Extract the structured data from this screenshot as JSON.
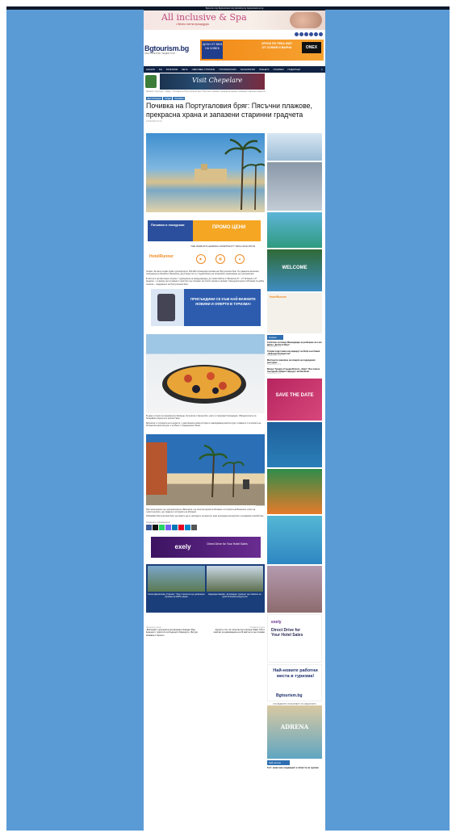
{
  "top_links": "Bgtourism.bg    Bgdestination.bg    bgholiday.bg    bgdestinations.bg",
  "banner_top": {
    "title": "All inclusive & Spa",
    "subtitle": "• Вечно лятна процедура"
  },
  "site": {
    "logo": "Bgtourism.bg",
    "logo_sub": "НАШ СЪВЕТНИК | МЕДИЯ ГРУП"
  },
  "promo": {
    "box": "ЦЕНИ ОТ 580€ НА ЧОВЕК",
    "mid_title": "КРУИЗ ПО РЕКА НИЛ",
    "mid_sub": "ОТ СОФИЯ И ВАРНА",
    "brand": "ONEX"
  },
  "nav": [
    "НАЧАЛО",
    "BG",
    "БЪЛГАРИЯ",
    "МЕТА",
    "СВЕТОВЕН ТУРИЗЪМ",
    "ТУРОПЕРАТОРИ",
    "ТЕХНОЛОГИИ",
    "ПЛАНЕТА",
    "ПОЧИВКИ",
    "ПОДАРЪЦИ"
  ],
  "ad_strip": {
    "title": "Visit Chepelare"
  },
  "breadcrumb": "Начало > Култура > Гайди > Почивка на Португалския бряг: Пясъчни плажове, прекрасна храна и запазени старинни градчета",
  "tags": [
    "ДЕСТИНАЦИИ",
    "ГАЙДИ",
    "ПОЧИВКА"
  ],
  "article": {
    "title": "Почивка на Португаловия бряг: Пясъчни плажове, прекрасна храна и запазени старинни градчета",
    "date": "16/06/2025 07:20",
    "hotelrunner": "THE WORLD'S LEADING HOSPITALITY TECH SOLUTION",
    "promo_title": "Почивки и екскурзии",
    "promo_price": "ПРОМО ЦЕНИ",
    "p1": "София. За света първи грийн туроператорът SOLVEX организира почивки на Португалския бряг. Пътуванията включват посещения на Лисабон и Валенсия, дегустации по път, съдействието на испанските организации на туроператора.",
    "p2": "В чистия и на светлинни отпуски с туроператор за международен, до голям бийсли от Валенсия 27 – 27 Испания 1 27 Андалус – по време на пътуването туристите ще опознаят на тихите часове и калинки. Свещената кухня и Испания са добре позната – гладуването на Португалския бряг.",
    "newsletter": "ПРИСЪЕДИНИ СЕ КЪМ НАЙ-ВАЖНИТЕ НОВИНИ И ОФЕРТИ В ТУРИЗМА!",
    "p3": "В девет отпуски за прекрасните Ирланди, Колегатор и Корнегейте, както и гласувани 5 фондации. Обредителните са безкрайни градчета из цялата Пени.",
    "p4": "Валенсия е столицата на съседното, с девствената нейна история и завладяваща архитектура, сливането с историята на Испанската архитектура, е особено с традиционна Палас.",
    "caption": "Валенсия",
    "p5": "При посещението на туроператорите в Валенсия, ще посетим музей на Испания с историята на Валенсия, които на туристическите, на сградите и историята на Испания.",
    "p6": "Избирайки Португалския бряг, ще можете да се насладите на красота, ново кулинарно наследство и несравним спокойствие.",
    "share_label": "Споделете публикацията:",
    "exely": "Direct Drive for Your Hotel Sales",
    "related_left": "Селия Даниелова „Гласове“: Тази стратегия ще дефинира туризма на 2025 година",
    "related_right": "Надежда Нанова: „Кулинарен туризъм“ ще помогне за туристическата индустрия",
    "prev_label": "Предишна статия",
    "next_label": "Следваща статия",
    "prev_title": "„Вселенай“ туроператор възприема в Канада: Във водещото туристите за бъдещото Маршруте, Фигури, Канбака и Торонто",
    "next_title": "Курортът Св. Св. Константин и Елена обяви ОТК и няколко за развиващата на 29 май за пътни почивки"
  },
  "sidebar": {
    "welcome_ad": "WELCOME",
    "news_header": "Новини",
    "news": [
      {
        "title": "Собствен хотелиер Минанджади за разбиране на х-ми Дебел „Де Регал Брус“",
        "date": "16/06/2025 07:20"
      },
      {
        "title": "Голяма подготовка нов маршрут на Кипр към Хижия „Фейзорм Колидиотна“",
        "date": "16/06/2025 07:20"
      },
      {
        "title": "Мистерите хамелион на кладата на подредения ресторант",
        "date": "16/06/2025 07:20"
      },
      {
        "title": "Бизнес Турция и Гърция Вопите „Зима“: Все повече български избират офроуд с автомобили",
        "date": "16/06/2025 07:20"
      }
    ],
    "save_the_date": "SAVE THE DATE",
    "exely": "Direct Drive for Your Hotel Sales",
    "jobs": "Най-новите работни места в туризма!",
    "jobs_logo": "Bgtourism.bg",
    "magazine_label": "ПОСЛЕДНИЯТ СПИСАНИЕТО НА ИЗДАНИЕТО",
    "magazine_title": "ADRENA",
    "bottom_label": "Най-четени",
    "bottom_text": "Гост: какво има следващият в областта на туризма"
  }
}
